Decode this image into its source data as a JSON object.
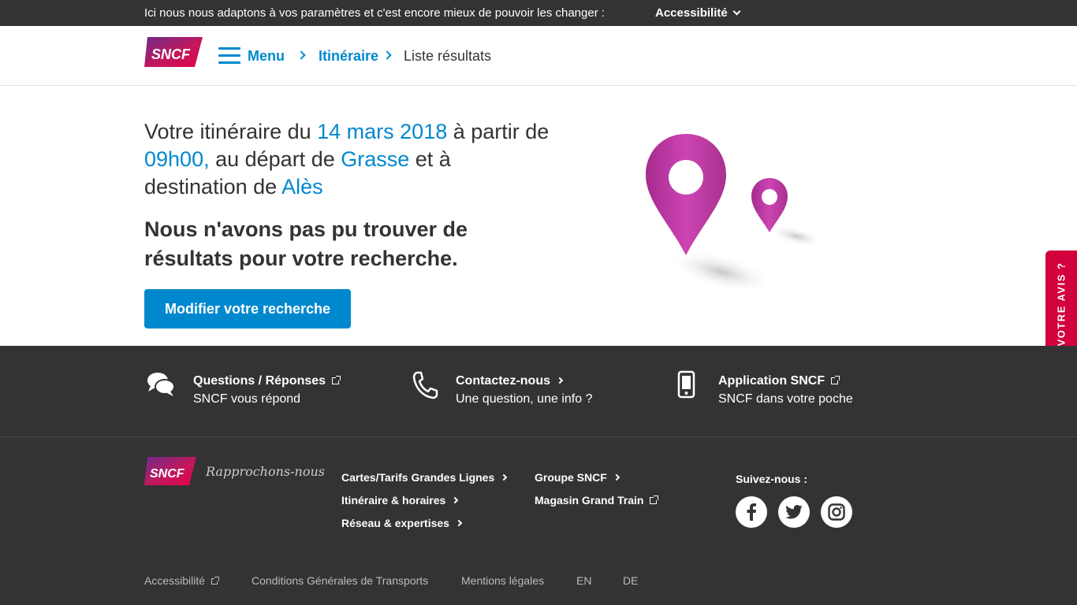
{
  "topbar": {
    "message": "Ici nous nous adaptons à vos paramètres et c'est encore mieux de pouvoir les changer :",
    "accessibility_label": "Accessibilité"
  },
  "header": {
    "logo_text": "SNCF",
    "menu_label": "Menu",
    "breadcrumb": [
      "Itinéraire",
      "Liste résultats"
    ]
  },
  "hero": {
    "p1": "Votre itinéraire du ",
    "date": "14 mars 2018",
    "p2": " à partir de ",
    "time": "09h00,",
    "p3": " au départ de ",
    "origin": "Grasse",
    "p4": " et à destination de ",
    "destination": "Alès",
    "no_result": "Nous n'avons pas pu trouver de résultats pour votre recherche.",
    "modify_button": "Modifier votre recherche"
  },
  "feedback_tab": "VOTRE AVIS ?",
  "footer": {
    "services": [
      {
        "title": "Questions / Réponses",
        "subtitle": "SNCF vous répond",
        "icon": "chat-bubbles-icon"
      },
      {
        "title": "Contactez-nous",
        "subtitle": "Une question, une info ?",
        "icon": "phone-icon"
      },
      {
        "title": "Application SNCF",
        "subtitle": "SNCF dans votre poche",
        "icon": "smartphone-icon"
      }
    ],
    "logo_text": "SNCF",
    "tagline": "Rapprochons-nous",
    "links_col1": [
      "Cartes/Tarifs Grandes Lignes",
      "Itinéraire & horaires",
      "Réseau & expertises"
    ],
    "links_col2": [
      "Groupe SNCF",
      "Magasin Grand Train"
    ],
    "follow_label": "Suivez-nous :",
    "social": [
      "facebook-icon",
      "twitter-icon",
      "instagram-icon"
    ],
    "legal": [
      "Accessibilité",
      "Conditions Générales de Transports",
      "Mentions légales",
      "EN",
      "DE"
    ]
  },
  "colors": {
    "accent": "#0088ce",
    "dark": "#333333",
    "feedback": "#d2003c",
    "pin": "#c13ba8"
  }
}
